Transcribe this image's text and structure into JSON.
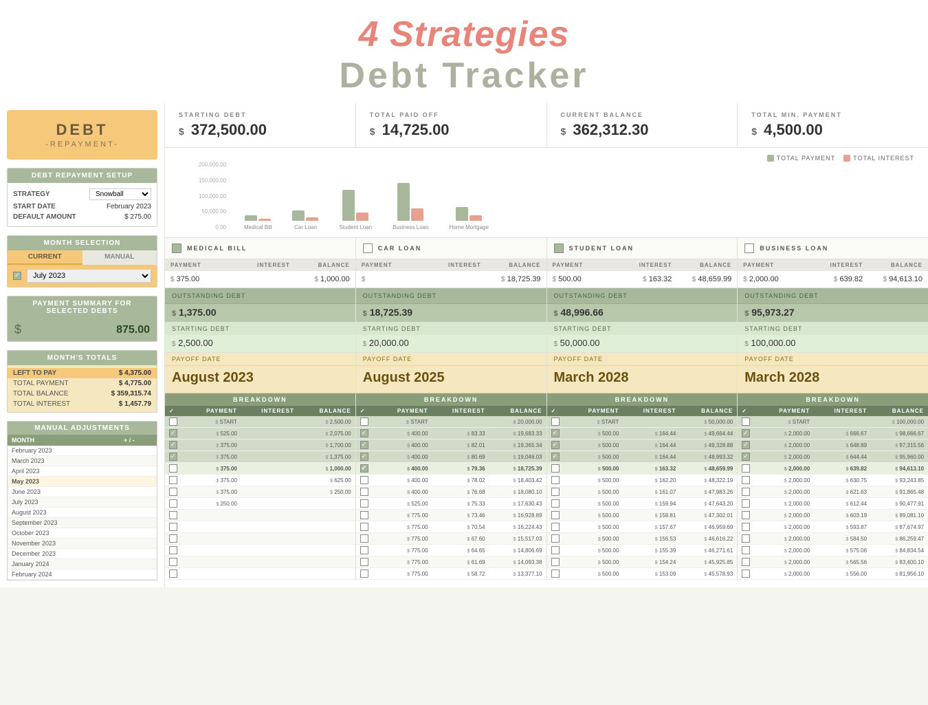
{
  "header": {
    "title_strategies": "4 Strategies",
    "title_debt": "Debt Tracker"
  },
  "sidebar": {
    "logo": {
      "title": "DEBT",
      "subtitle": "-REPAYMENT-"
    },
    "setup": {
      "section_title": "DEBT REPAYMENT SETUP",
      "strategy_label": "STRATEGY",
      "strategy_value": "Snowball",
      "start_date_label": "START DATE",
      "start_date_value": "February 2023",
      "default_amount_label": "DEFAULT AMOUNT",
      "default_amount_currency": "$",
      "default_amount_value": "275.00"
    },
    "month_selection": {
      "section_title": "MONTH SELECTION",
      "tab_current": "CURRENT",
      "tab_manual": "MANUAL",
      "selected_month": "July 2023"
    },
    "payment_summary": {
      "section_title": "PAYMENT SUMMARY FOR SELECTED DEBTS",
      "currency": "$",
      "value": "875.00"
    },
    "months_totals": {
      "section_title": "MONTH'S TOTALS",
      "rows": [
        {
          "label": "LEFT TO PAY",
          "currency": "$",
          "value": "4,375.00"
        },
        {
          "label": "TOTAL PAYMENT",
          "currency": "$",
          "value": "4,775.00"
        },
        {
          "label": "TOTAL BALANCE",
          "currency": "$",
          "value": "359,315.74"
        },
        {
          "label": "TOTAL INTEREST",
          "currency": "$",
          "value": "1,457.79"
        }
      ]
    },
    "manual_adjustments": {
      "section_title": "MANUAL ADJUSTMENTS",
      "col_month": "MONTH",
      "col_adj": "+ / -",
      "rows": [
        {
          "month": "February 2023",
          "adj": ""
        },
        {
          "month": "March 2023",
          "adj": ""
        },
        {
          "month": "April 2023",
          "adj": ""
        },
        {
          "month": "May 2023",
          "adj": "",
          "active": true
        },
        {
          "month": "June 2023",
          "adj": ""
        },
        {
          "month": "July 2023",
          "adj": ""
        },
        {
          "month": "August 2023",
          "adj": ""
        },
        {
          "month": "September 2023",
          "adj": ""
        },
        {
          "month": "October 2023",
          "adj": ""
        },
        {
          "month": "November 2023",
          "adj": ""
        },
        {
          "month": "December 2023",
          "adj": ""
        },
        {
          "month": "January 2024",
          "adj": ""
        },
        {
          "month": "February 2024",
          "adj": ""
        }
      ]
    }
  },
  "stats": {
    "starting_debt": {
      "label": "STARTING  DEBT",
      "currency": "$",
      "value": "372,500.00"
    },
    "total_paid_off": {
      "label": "TOTAL PAID OFF",
      "currency": "$",
      "value": "14,725.00"
    },
    "current_balance": {
      "label": "CURRENT  BALANCE",
      "currency": "$",
      "value": "362,312.30"
    },
    "total_min_payment": {
      "label": "TOTAL MIN. PAYMENT",
      "currency": "$",
      "value": "4,500.00"
    }
  },
  "chart": {
    "legend": {
      "payment_label": "TOTAL PAYMENT",
      "interest_label": "TOTAL INTEREST"
    },
    "y_labels": [
      "200,000.00",
      "150,000.00",
      "100,000.00",
      "50,000.00",
      "0.00"
    ],
    "bars": [
      {
        "label": "Medical Bill",
        "payment_h": 8,
        "interest_h": 3
      },
      {
        "label": "Car Loan",
        "payment_h": 15,
        "interest_h": 5
      },
      {
        "label": "Student Loan",
        "payment_h": 45,
        "interest_h": 12
      },
      {
        "label": "Business Loan",
        "payment_h": 55,
        "interest_h": 18
      },
      {
        "label": "Home Mortgage",
        "payment_h": 20,
        "interest_h": 8
      }
    ]
  },
  "debts": [
    {
      "id": "medical_bill",
      "title": "MEDICAL BILL",
      "checked": true,
      "payment": "375.00",
      "interest": "",
      "balance": "1,000.00",
      "outstanding": "1,375.00",
      "starting": "2,500.00",
      "payoff_date": "August 2023",
      "breakdown_rows": [
        {
          "checked": true,
          "payment": "525.00",
          "interest": "",
          "balance": "2,075.00",
          "shaded": true
        },
        {
          "checked": true,
          "payment": "375.00",
          "interest": "",
          "balance": "1,700.00",
          "shaded": true
        },
        {
          "checked": true,
          "payment": "375.00",
          "interest": "",
          "balance": "1,375.00",
          "shaded": true
        },
        {
          "checked": false,
          "payment": "375.00",
          "interest": "",
          "balance": "1,000.00",
          "highlighted": true
        },
        {
          "checked": false,
          "payment": "375.00",
          "interest": "",
          "balance": "625.00"
        },
        {
          "checked": false,
          "payment": "375.00",
          "interest": "",
          "balance": "250.00"
        },
        {
          "checked": false,
          "payment": "250.00",
          "interest": "",
          "balance": ""
        },
        {
          "checked": false,
          "payment": "",
          "interest": "",
          "balance": ""
        },
        {
          "checked": false,
          "payment": "",
          "interest": "",
          "balance": ""
        },
        {
          "checked": false,
          "payment": "",
          "interest": "",
          "balance": ""
        },
        {
          "checked": false,
          "payment": "",
          "interest": "",
          "balance": ""
        },
        {
          "checked": false,
          "payment": "",
          "interest": "",
          "balance": ""
        },
        {
          "checked": false,
          "payment": "",
          "interest": "",
          "balance": ""
        }
      ]
    },
    {
      "id": "car_loan",
      "title": "CAR LOAN",
      "checked": false,
      "payment": "",
      "interest": "",
      "balance": "18,725.39",
      "outstanding": "18,725.39",
      "starting": "20,000.00",
      "payoff_date": "August 2025",
      "breakdown_rows": [
        {
          "checked": true,
          "payment": "400.00",
          "interest": "83.33",
          "balance": "19,683.33",
          "shaded": true
        },
        {
          "checked": true,
          "payment": "400.00",
          "interest": "82.01",
          "balance": "19,365.34",
          "shaded": true
        },
        {
          "checked": true,
          "payment": "400.00",
          "interest": "80.69",
          "balance": "19,046.03",
          "shaded": true
        },
        {
          "checked": true,
          "payment": "400.00",
          "interest": "79.36",
          "balance": "18,725.39",
          "highlighted": true
        },
        {
          "checked": false,
          "payment": "400.00",
          "interest": "78.02",
          "balance": "18,403.42"
        },
        {
          "checked": false,
          "payment": "400.00",
          "interest": "76.68",
          "balance": "18,080.10"
        },
        {
          "checked": false,
          "payment": "525.00",
          "interest": "75.33",
          "balance": "17,630.43"
        },
        {
          "checked": false,
          "payment": "775.00",
          "interest": "73.46",
          "balance": "16,928.89"
        },
        {
          "checked": false,
          "payment": "775.00",
          "interest": "70.54",
          "balance": "16,224.43"
        },
        {
          "checked": false,
          "payment": "775.00",
          "interest": "67.60",
          "balance": "15,517.03"
        },
        {
          "checked": false,
          "payment": "775.00",
          "interest": "64.65",
          "balance": "14,806.69"
        },
        {
          "checked": false,
          "payment": "775.00",
          "interest": "61.69",
          "balance": "14,093.38"
        },
        {
          "checked": false,
          "payment": "775.00",
          "interest": "58.72",
          "balance": "13,377.10"
        }
      ]
    },
    {
      "id": "student_loan",
      "title": "STUDENT LOAN",
      "checked": true,
      "payment": "500.00",
      "interest": "163.32",
      "balance": "48,659.99",
      "outstanding": "48,996.66",
      "starting": "50,000.00",
      "payoff_date": "March 2028",
      "breakdown_rows": [
        {
          "checked": true,
          "payment": "500.00",
          "interest": "164.44",
          "balance": "49,664.44",
          "shaded": true
        },
        {
          "checked": true,
          "payment": "500.00",
          "interest": "164.44",
          "balance": "49,328.88",
          "shaded": true
        },
        {
          "checked": true,
          "payment": "500.00",
          "interest": "164.44",
          "balance": "48,993.32",
          "shaded": true
        },
        {
          "checked": false,
          "payment": "500.00",
          "interest": "163.32",
          "balance": "48,659.99",
          "highlighted": true
        },
        {
          "checked": false,
          "payment": "500.00",
          "interest": "162.20",
          "balance": "48,322.19"
        },
        {
          "checked": false,
          "payment": "500.00",
          "interest": "161.07",
          "balance": "47,983.26"
        },
        {
          "checked": false,
          "payment": "500.00",
          "interest": "159.94",
          "balance": "47,643.20"
        },
        {
          "checked": false,
          "payment": "500.00",
          "interest": "158.81",
          "balance": "47,302.01"
        },
        {
          "checked": false,
          "payment": "500.00",
          "interest": "157.67",
          "balance": "46,959.69"
        },
        {
          "checked": false,
          "payment": "500.00",
          "interest": "156.53",
          "balance": "46,616.22"
        },
        {
          "checked": false,
          "payment": "500.00",
          "interest": "155.39",
          "balance": "46,271.61"
        },
        {
          "checked": false,
          "payment": "500.00",
          "interest": "154.24",
          "balance": "45,925.85"
        },
        {
          "checked": false,
          "payment": "500.00",
          "interest": "153.09",
          "balance": "45,578.93"
        }
      ]
    },
    {
      "id": "business_loan",
      "title": "BUSINESS LOAN",
      "checked": false,
      "payment": "2,000.00",
      "interest": "639.82",
      "balance": "94,613.10",
      "outstanding": "95,973.27",
      "starting": "100,000.00",
      "payoff_date": "March 2028",
      "breakdown_rows": [
        {
          "checked": true,
          "payment": "2,000.00",
          "interest": "666.67",
          "balance": "98,666.67",
          "shaded": true
        },
        {
          "checked": true,
          "payment": "2,000.00",
          "interest": "648.89",
          "balance": "97,315.56",
          "shaded": true
        },
        {
          "checked": true,
          "payment": "2,000.00",
          "interest": "644.44",
          "balance": "95,960.00",
          "shaded": true
        },
        {
          "checked": false,
          "payment": "2,000.00",
          "interest": "639.82",
          "balance": "94,613.10",
          "highlighted": true
        },
        {
          "checked": false,
          "payment": "2,000.00",
          "interest": "630.75",
          "balance": "93,243.85"
        },
        {
          "checked": false,
          "payment": "2,000.00",
          "interest": "621.63",
          "balance": "91,865.48"
        },
        {
          "checked": false,
          "payment": "2,000.00",
          "interest": "612.44",
          "balance": "90,477.91"
        },
        {
          "checked": false,
          "payment": "2,000.00",
          "interest": "603.19",
          "balance": "89,081.10"
        },
        {
          "checked": false,
          "payment": "2,000.00",
          "interest": "593.87",
          "balance": "87,674.97"
        },
        {
          "checked": false,
          "payment": "2,000.00",
          "interest": "584.50",
          "balance": "86,259.47"
        },
        {
          "checked": false,
          "payment": "2,000.00",
          "interest": "575.06",
          "balance": "84,834.54"
        },
        {
          "checked": false,
          "payment": "2,000.00",
          "interest": "565.56",
          "balance": "83,400.10"
        },
        {
          "checked": false,
          "payment": "2,000.00",
          "interest": "556.00",
          "balance": "81,956.10"
        }
      ]
    }
  ]
}
